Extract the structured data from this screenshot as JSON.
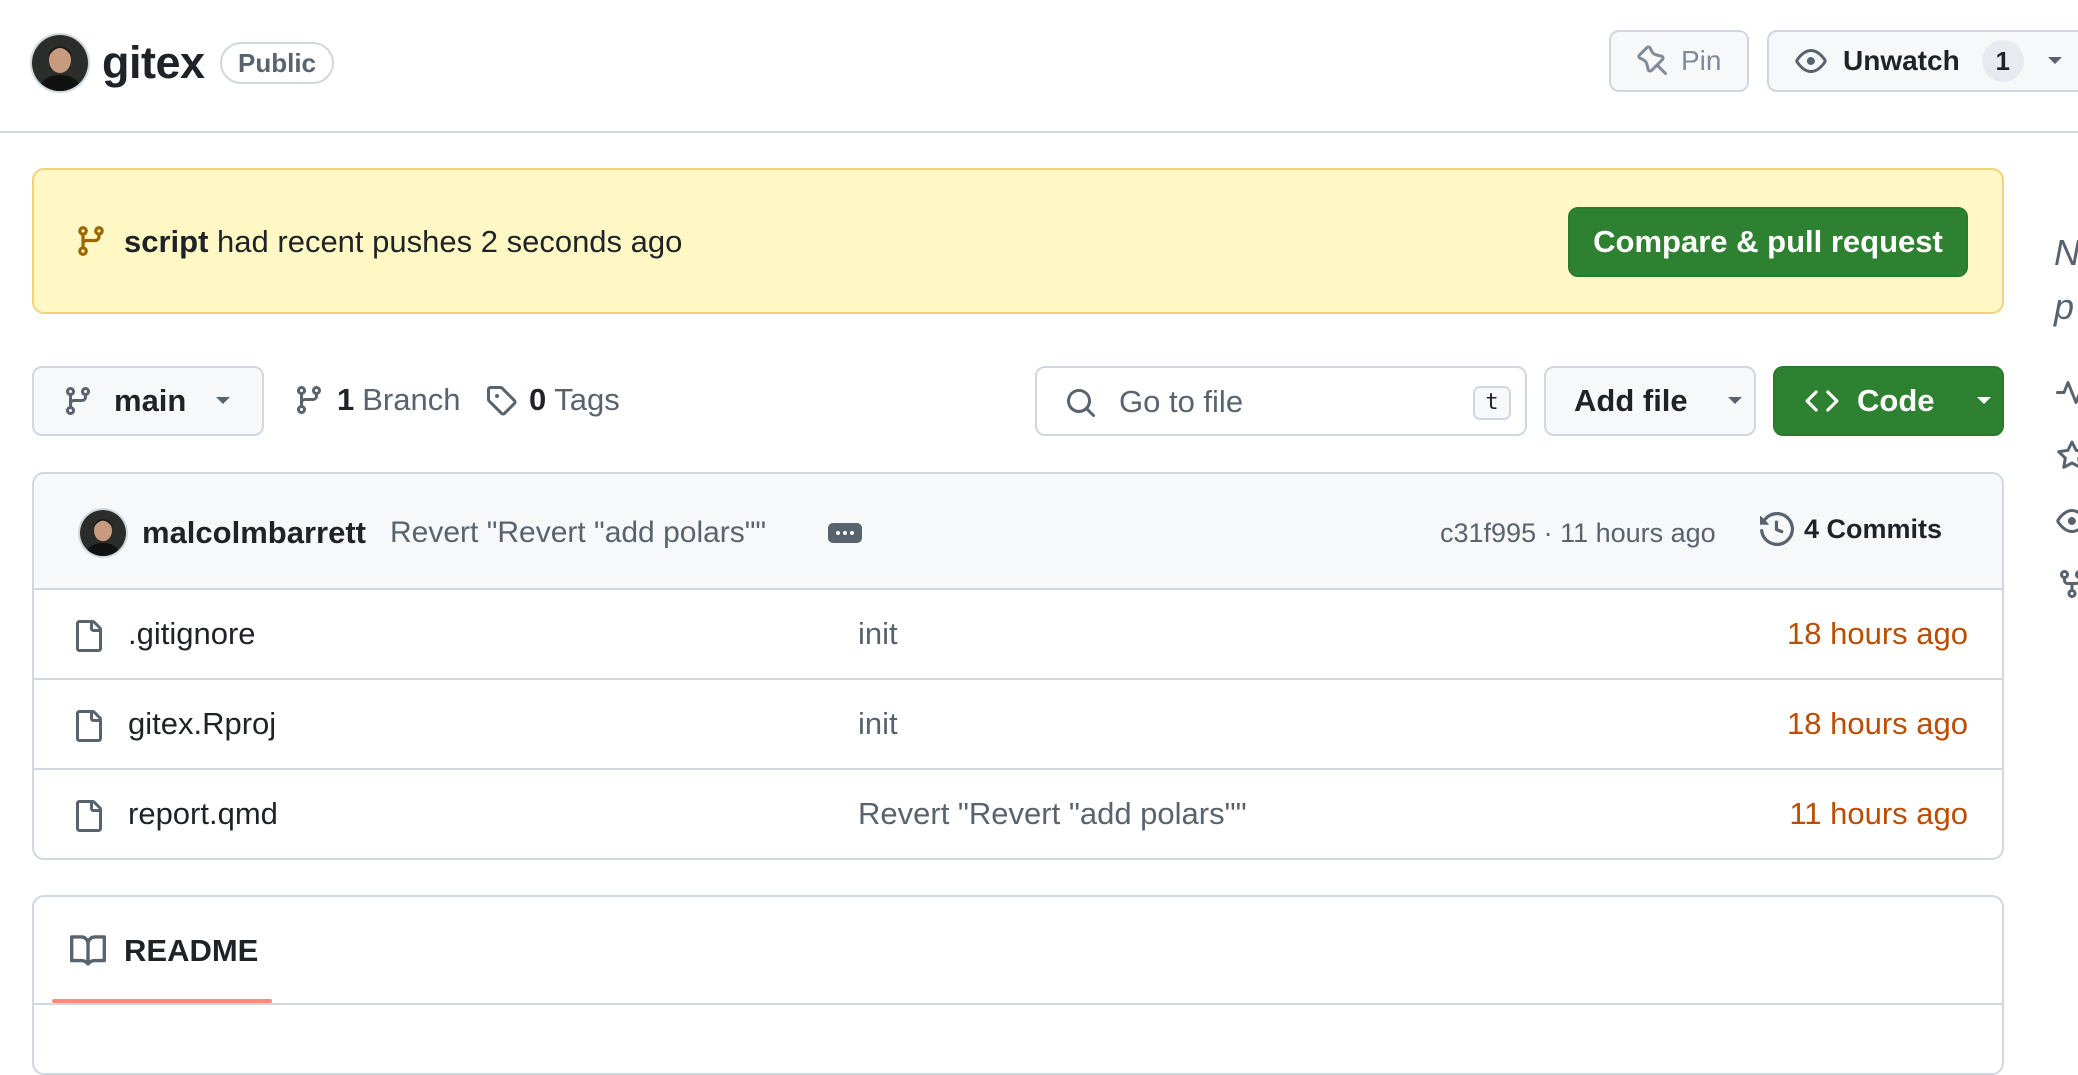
{
  "repo": {
    "name": "gitex",
    "visibility": "Public",
    "pin_label": "Pin",
    "watch_label": "Unwatch",
    "watch_count": "1"
  },
  "banner": {
    "branch": "script",
    "message": "had recent pushes 2 seconds ago",
    "compare_label": "Compare & pull request"
  },
  "toolbar": {
    "branch": "main",
    "branch_count": "1",
    "branch_word": "Branch",
    "tag_count": "0",
    "tag_word": "Tags",
    "search_placeholder": "Go to file",
    "search_shortcut": "t",
    "add_file_label": "Add file",
    "code_label": "Code"
  },
  "latest_commit": {
    "author": "malcolmbarrett",
    "message": "Revert \"Revert \"add polars\"\"",
    "sha_time": "c31f995 · 11 hours ago",
    "commits_label": "4 Commits"
  },
  "files": [
    {
      "name": ".gitignore",
      "commit": "init",
      "time": "18 hours ago"
    },
    {
      "name": "gitex.Rproj",
      "commit": "init",
      "time": "18 hours ago"
    },
    {
      "name": "report.qmd",
      "commit": "Revert \"Revert \"add polars\"\"",
      "time": "11 hours ago"
    }
  ],
  "readme": {
    "tab_label": "README"
  },
  "sidebar": {
    "line1": "N",
    "line2": "p"
  },
  "colors": {
    "primary_green": "#2f8132",
    "banner_bg": "#fff8c5",
    "time_orange": "#bc4c00",
    "underline": "#fd8c73",
    "border": "#d0d7de"
  }
}
